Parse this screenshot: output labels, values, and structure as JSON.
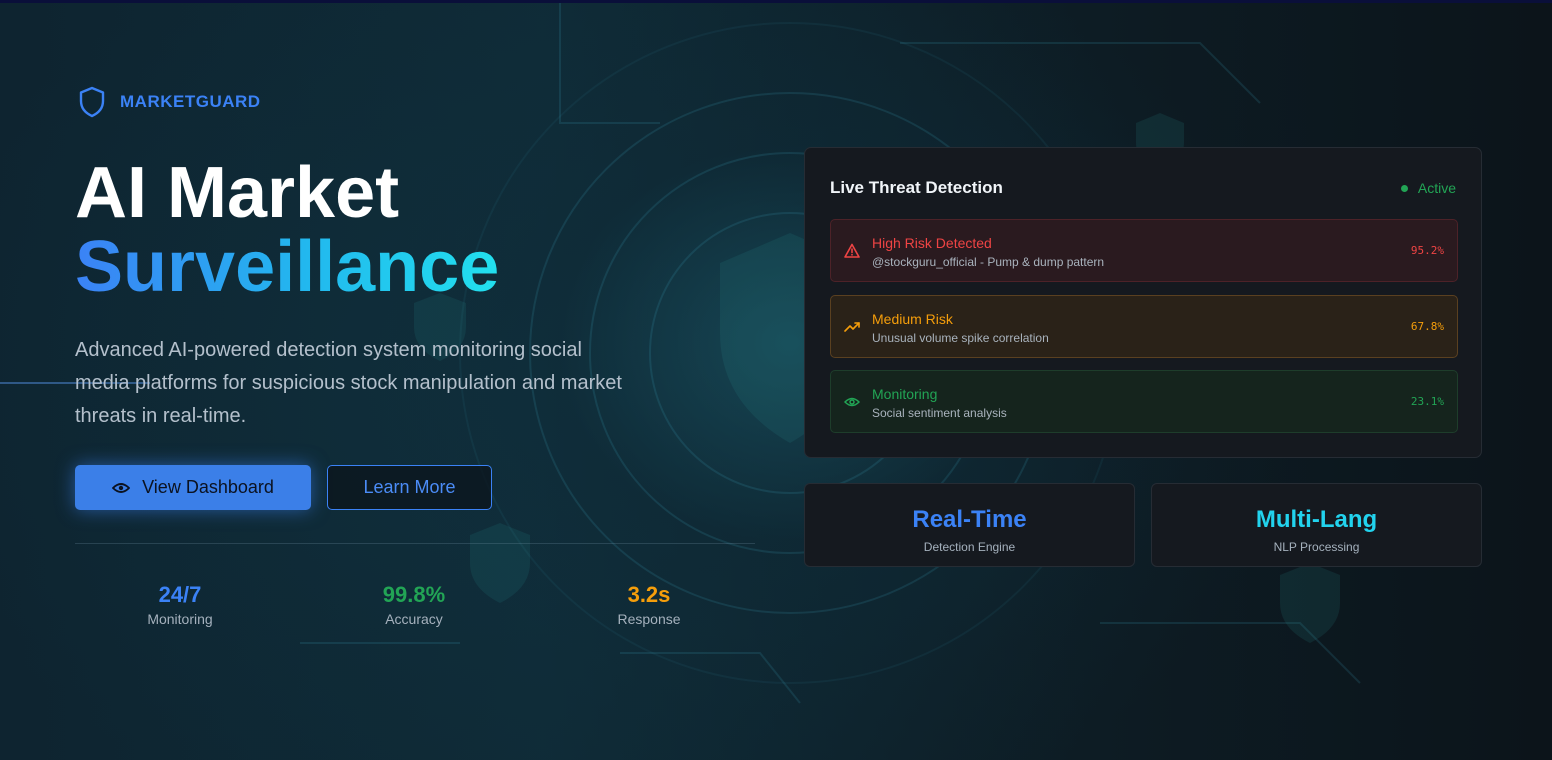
{
  "brand": {
    "name": "MARKETGUARD",
    "icon": "shield-icon"
  },
  "hero": {
    "title_line1": "AI Market",
    "title_line2": "Surveillance",
    "description": "Advanced AI-powered detection system monitoring social media platforms for suspicious stock manipulation and market threats in real-time."
  },
  "buttons": {
    "primary_label": "View Dashboard",
    "primary_icon": "eye-icon",
    "secondary_label": "Learn More"
  },
  "stats": [
    {
      "value": "24/7",
      "label": "Monitoring",
      "color": "#3b82f6"
    },
    {
      "value": "99.8%",
      "label": "Accuracy",
      "color": "#22a455"
    },
    {
      "value": "3.2s",
      "label": "Response",
      "color": "#f59e0b"
    }
  ],
  "panel": {
    "title": "Live Threat Detection",
    "status": "Active",
    "alerts": [
      {
        "title": "High Risk Detected",
        "subtitle": "@stockguru_official - Pump & dump pattern",
        "percent": "95.2%",
        "icon": "warning-triangle-icon",
        "color": "#ef4444"
      },
      {
        "title": "Medium Risk",
        "subtitle": "Unusual volume spike correlation",
        "percent": "67.8%",
        "icon": "trending-up-icon",
        "color": "#f59e0b"
      },
      {
        "title": "Monitoring",
        "subtitle": "Social sentiment analysis",
        "percent": "23.1%",
        "icon": "eye-icon",
        "color": "#22a455"
      }
    ]
  },
  "features": [
    {
      "title": "Real-Time",
      "subtitle": "Detection Engine",
      "color": "#3b82f6"
    },
    {
      "title": "Multi-Lang",
      "subtitle": "NLP Processing",
      "color": "#22d3ee"
    }
  ]
}
